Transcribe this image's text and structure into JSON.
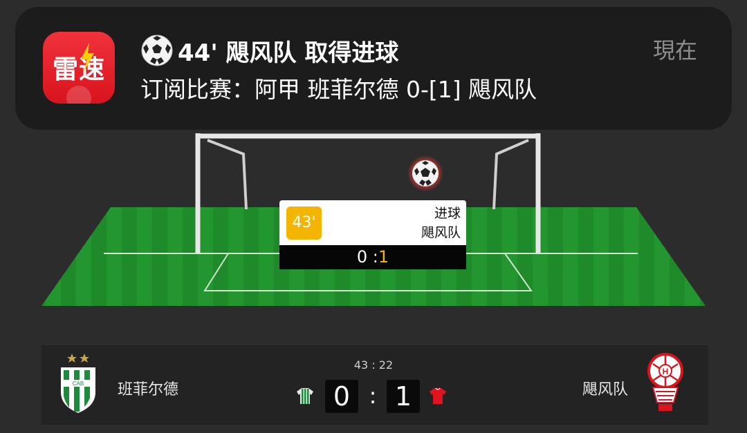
{
  "notification": {
    "app_icon_text": "雷速",
    "title": "44' 飓风队 取得进球",
    "body": "订阅比赛：阿甲 班菲尔德 0-[1] 飓风队",
    "time": "現在"
  },
  "event_card": {
    "minute": "43'",
    "type": "进球",
    "team": "飓风队",
    "score_home": "0",
    "score_separator": " :",
    "score_away": "1"
  },
  "scoreboard": {
    "home_team": "班菲尔德",
    "away_team": "飓风队",
    "match_time": "43 : 22",
    "home_score": "0",
    "separator": ":",
    "away_score": "1",
    "home_crest_text": "CAB"
  },
  "colors": {
    "accent_yellow": "#f3b500",
    "app_red": "#e02028",
    "home_green": "#1e8a3c",
    "away_red": "#d8141e"
  },
  "icons": [
    "soccer-ball-icon",
    "lightning-icon",
    "home-jersey-icon",
    "away-jersey-icon"
  ]
}
